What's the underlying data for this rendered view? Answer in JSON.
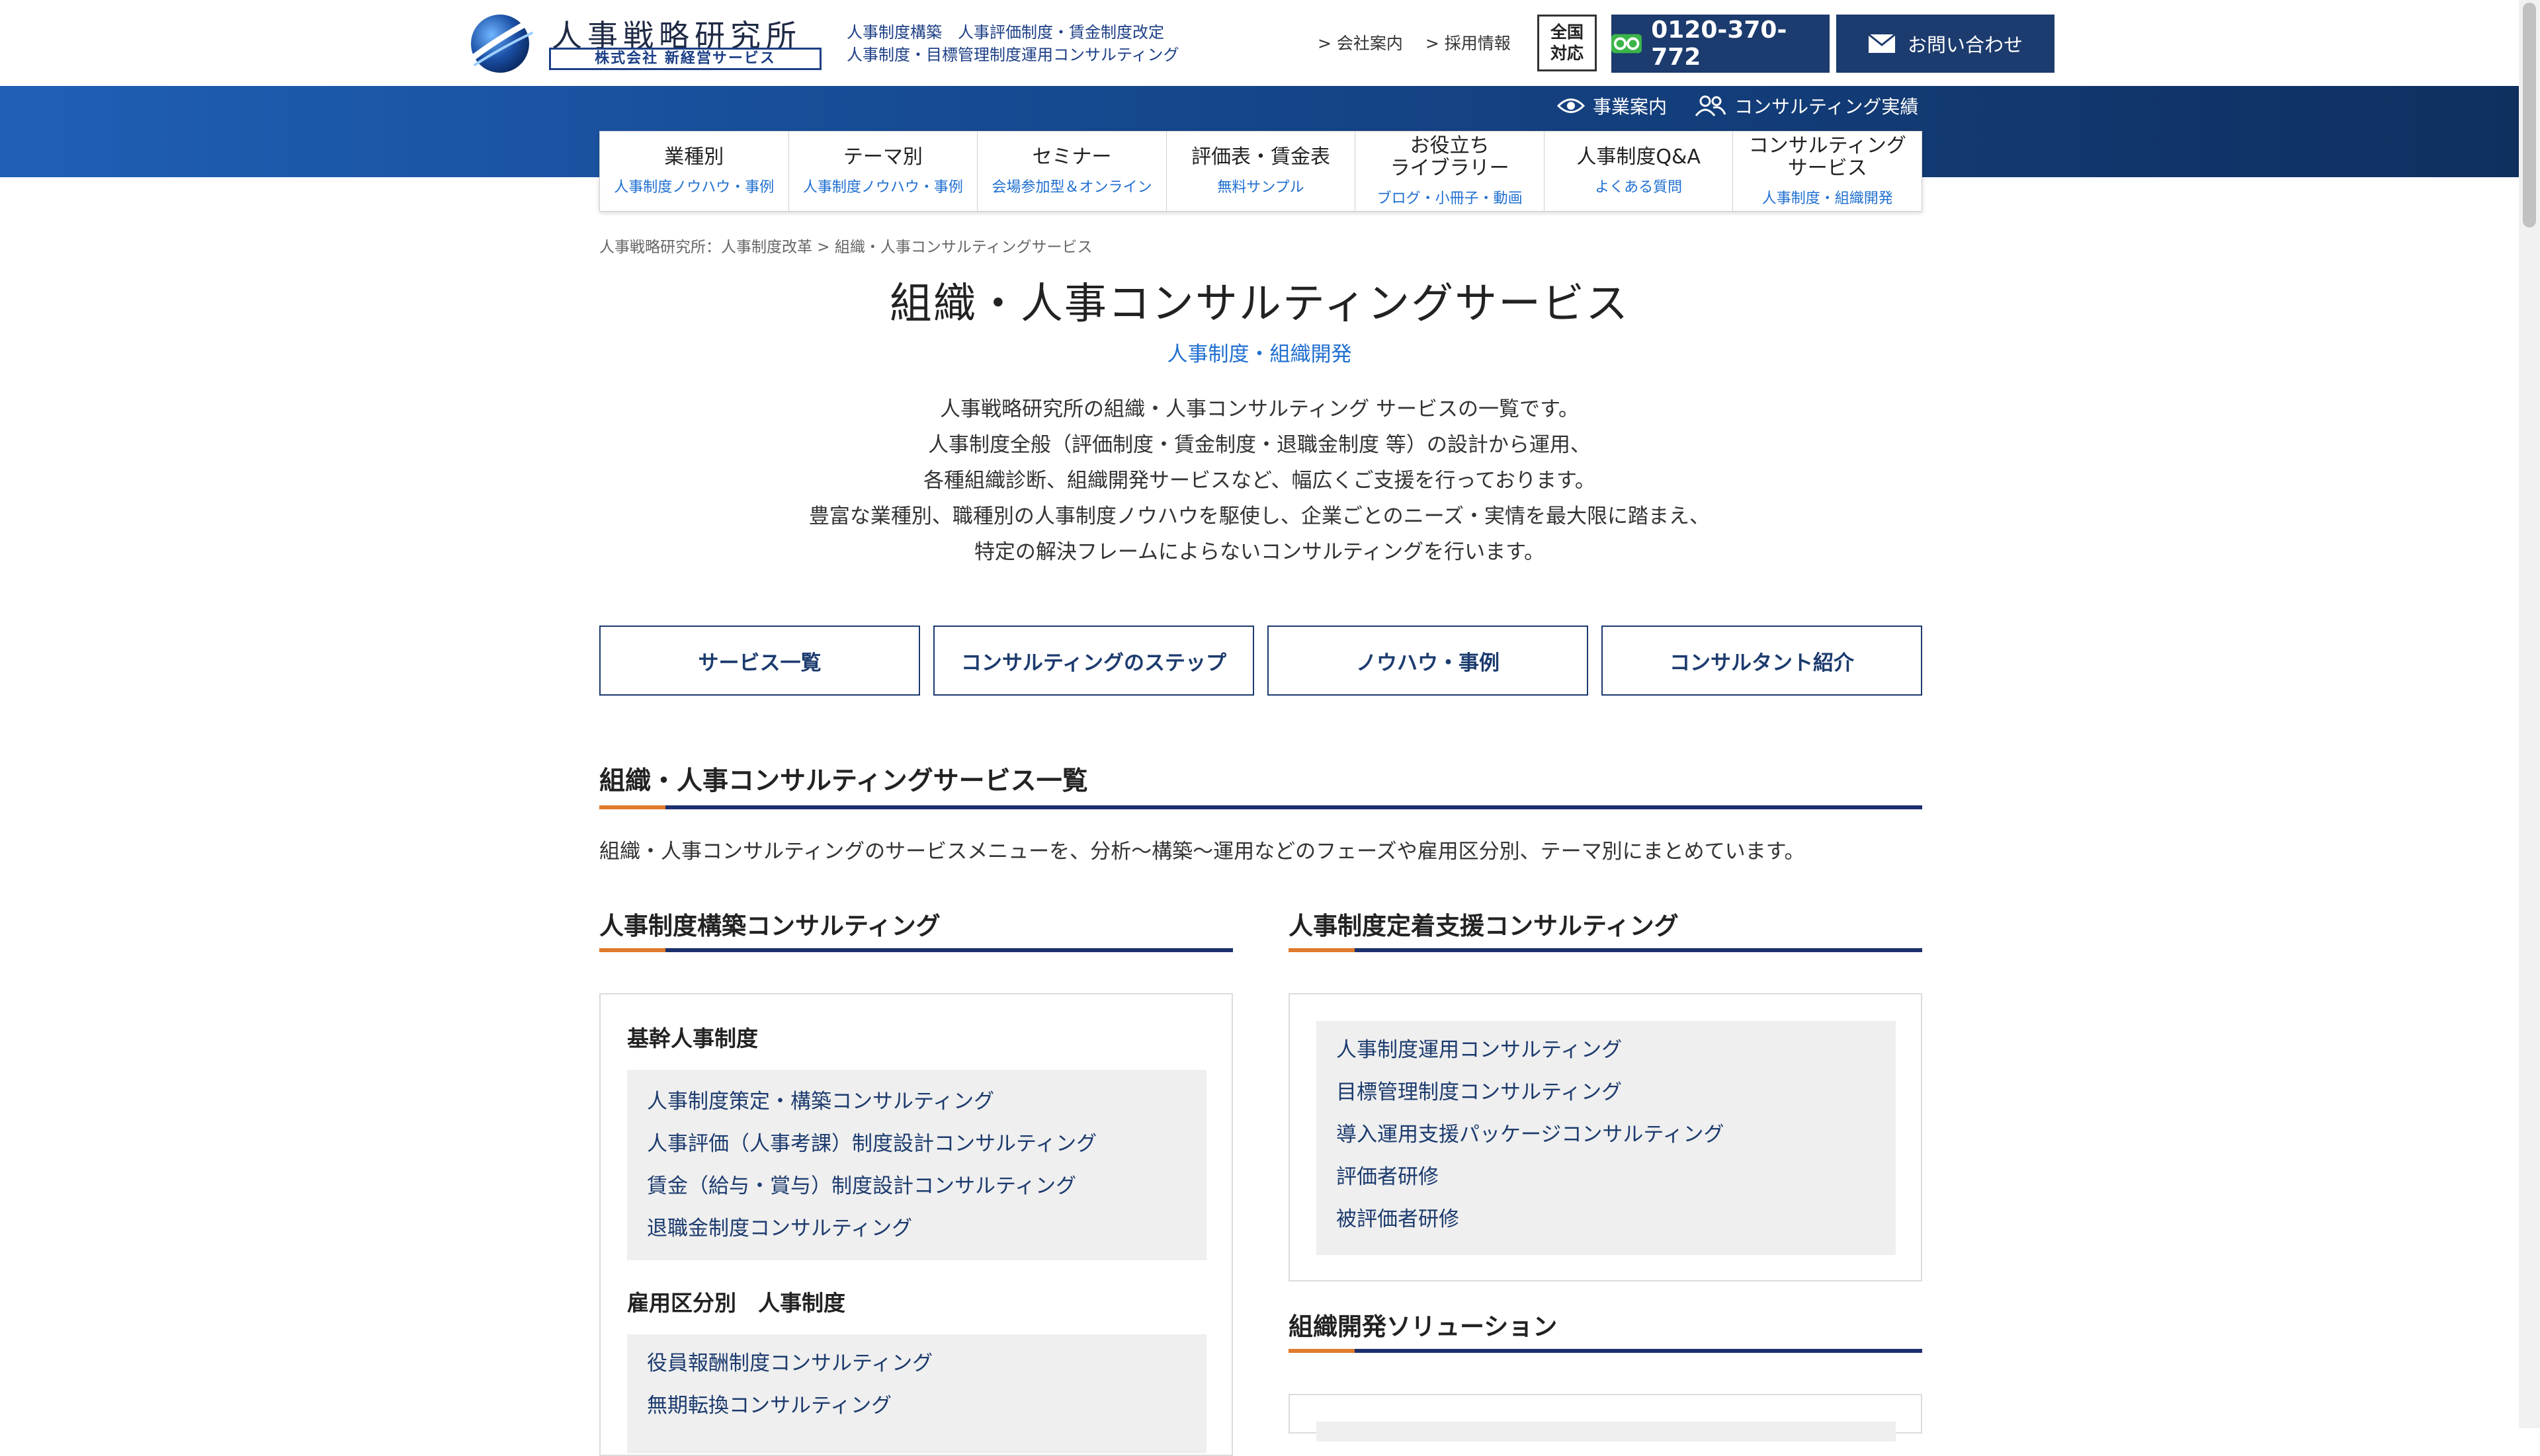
{
  "header": {
    "logo_name": "人事戦略研究所",
    "logo_company": "株式会社 新経営サービス",
    "tags_line1": "人事制度構築　人事評価制度・賃金制度改定",
    "tags_line2": "人事制度・目標管理制度運用コンサルティング",
    "links": [
      "> 会社案内",
      "> 採用情報"
    ],
    "nationwide": "全国\n対応",
    "phone": "0120-370-772",
    "contact": "お問い合わせ"
  },
  "band": {
    "business": "事業案内",
    "record": "コンサルティング実績"
  },
  "nav": [
    {
      "title": "業種別",
      "sub": "人事制度ノウハウ・事例"
    },
    {
      "title": "テーマ別",
      "sub": "人事制度ノウハウ・事例"
    },
    {
      "title": "セミナー",
      "sub": "会場参加型＆オンライン"
    },
    {
      "title": "評価表・賃金表",
      "sub": "無料サンプル"
    },
    {
      "title": "お役立ち\nライブラリー",
      "sub": "ブログ・小冊子・動画"
    },
    {
      "title": "人事制度Q&A",
      "sub": "よくある質問"
    },
    {
      "title": "コンサルティング\nサービス",
      "sub": "人事制度・組織開発"
    }
  ],
  "breadcrumb": "人事戦略研究所：人事制度改革 > 組織・人事コンサルティングサービス",
  "title": "組織・人事コンサルティングサービス",
  "subtitle": "人事制度・組織開発",
  "intro": [
    "人事戦略研究所の組織・人事コンサルティング サービスの一覧です。",
    "人事制度全般（評価制度・賃金制度・退職金制度 等）の設計から運用、",
    "各種組織診断、組織開発サービスなど、幅広くご支援を行っております。",
    "豊富な業種別、職種別の人事制度ノウハウを駆使し、企業ごとのニーズ・実情を最大限に踏まえ、",
    "特定の解決フレームによらないコンサルティングを行います。"
  ],
  "tabs": [
    "サービス一覧",
    "コンサルティングのステップ",
    "ノウハウ・事例",
    "コンサルタント紹介"
  ],
  "section": {
    "heading": "組織・人事コンサルティングサービス一覧",
    "desc": "組織・人事コンサルティングのサービスメニューを、分析〜構築〜運用などのフェーズや雇用区分別、テーマ別にまとめています。"
  },
  "left": {
    "heading": "人事制度構築コンサルティング",
    "group1": {
      "title": "基幹人事制度",
      "items": [
        "人事制度策定・構築コンサルティング",
        "人事評価（人事考課）制度設計コンサルティング",
        "賃金（給与・賞与）制度設計コンサルティング",
        "退職金制度コンサルティング"
      ]
    },
    "group2": {
      "title": "雇用区分別　人事制度",
      "items": [
        "役員報酬制度コンサルティング",
        "無期転換コンサルティング"
      ]
    }
  },
  "right": {
    "heading": "人事制度定着支援コンサルティング",
    "items": [
      "人事制度運用コンサルティング",
      "目標管理制度コンサルティング",
      "導入運用支援パッケージコンサルティング",
      "評価者研修",
      "被評価者研修"
    ],
    "heading2": "組織開発ソリューション"
  }
}
